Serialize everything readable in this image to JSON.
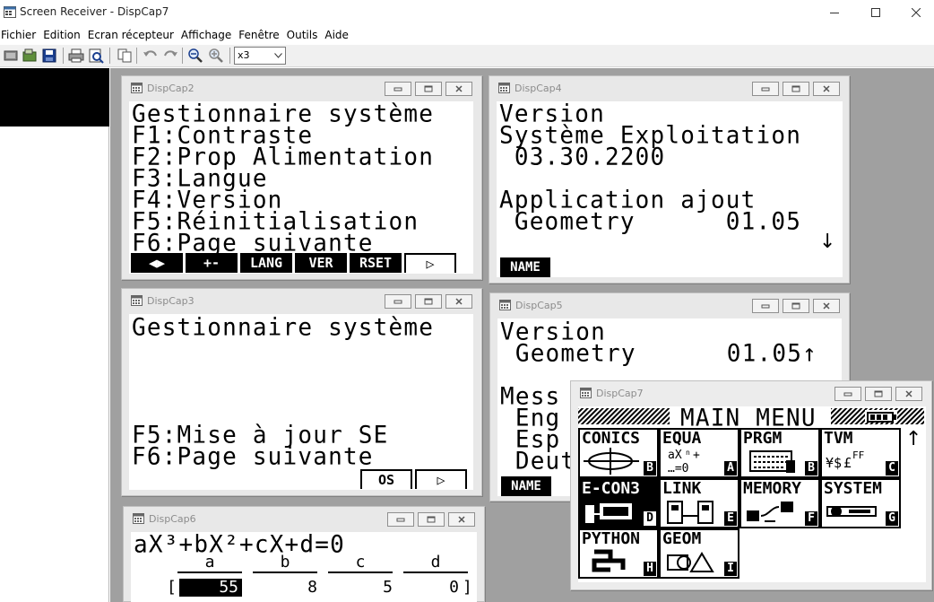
{
  "app": {
    "title": "Screen Receiver - DispCap7"
  },
  "menu": [
    "Fichier",
    "Edition",
    "Ecran récepteur",
    "Affichage",
    "Fenêtre",
    "Outils",
    "Aide"
  ],
  "toolbar": {
    "zoom_value": "x3",
    "icons": [
      "capture-icon",
      "open-capture-icon",
      "save-icon",
      "print-icon",
      "print-preview-icon",
      "copy-icon",
      "undo-icon",
      "redo-icon",
      "zoom-out-icon",
      "zoom-in-icon"
    ]
  },
  "windows": {
    "dc2": {
      "title": "DispCap2",
      "lines": [
        "Gestionnaire système",
        "F1:Contraste",
        "F2:Prop Alimentation",
        "F3:Langue",
        "F4:Version",
        "F5:Réinitialisation",
        "F6:Page suivante"
      ],
      "fkeys": [
        "◀▶",
        "+-",
        "LANG",
        "VER",
        "RSET",
        "▷"
      ]
    },
    "dc3": {
      "title": "DispCap3",
      "lines": [
        "Gestionnaire système",
        "F5:Mise à jour SE",
        "F6:Page suivante"
      ],
      "fkeys": [
        "OS",
        "▷"
      ]
    },
    "dc4": {
      "title": "DispCap4",
      "lines": [
        "Version",
        "Système Exploitation",
        " 03.30.2200",
        "Application ajout",
        " Geometry      01.05"
      ],
      "arrow": "↓",
      "fkey": "NAME"
    },
    "dc5": {
      "title": "DispCap5",
      "lines": [
        "Version",
        " Geometry      01.05↑",
        "Mess",
        " Eng",
        " Esp",
        " Deut"
      ],
      "fkey": "NAME"
    },
    "dc6": {
      "title": "DispCap6",
      "equation": "aX³+bX²+cX+d=0",
      "columns": [
        "a",
        "b",
        "c",
        "d"
      ],
      "values": [
        "55",
        "8",
        "5",
        "0"
      ],
      "bracket_open": "[",
      "bracket_close": "]"
    },
    "dc7": {
      "title": "DispCap7",
      "header": "MAIN MENU",
      "scroll_arrow": "↑",
      "apps": [
        {
          "label": "CONICS",
          "key": "B",
          "selected": false
        },
        {
          "label": "EQUA",
          "key": "A",
          "selected": false
        },
        {
          "label": "PRGM",
          "key": "B",
          "selected": false
        },
        {
          "label": "TVM",
          "key": "C",
          "selected": false
        },
        {
          "label": "E-CON3",
          "key": "D",
          "selected": true
        },
        {
          "label": "LINK",
          "key": "E",
          "selected": false
        },
        {
          "label": "MEMORY",
          "key": "F",
          "selected": false
        },
        {
          "label": "SYSTEM",
          "key": "G",
          "selected": false
        },
        {
          "label": "PYTHON",
          "key": "H",
          "selected": false
        },
        {
          "label": "GEOM",
          "key": "I",
          "selected": false
        }
      ]
    }
  },
  "colors": {
    "workspace": "#a0a0a0",
    "lcd_black": "#000000",
    "child_title_text": "#8c8c8c"
  }
}
